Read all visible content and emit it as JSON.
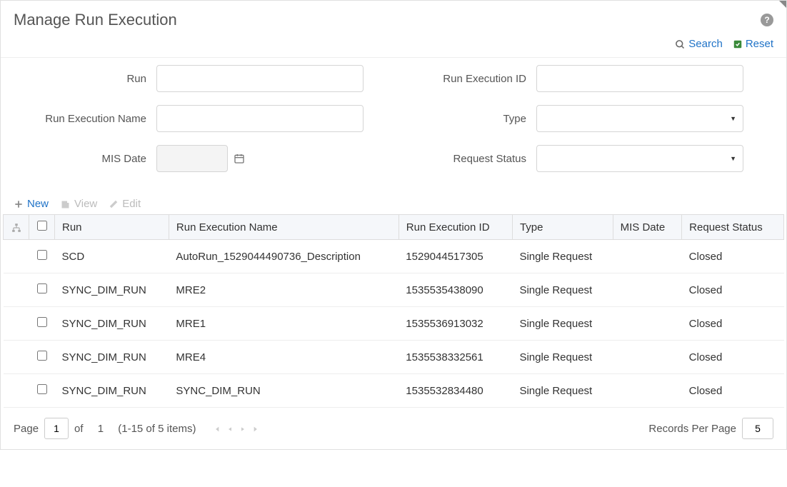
{
  "page_title": "Manage Run Execution",
  "top_actions": {
    "search": "Search",
    "reset": "Reset"
  },
  "form": {
    "run_label": "Run",
    "run_value": "",
    "exec_id_label": "Run Execution ID",
    "exec_id_value": "",
    "exec_name_label": "Run Execution Name",
    "exec_name_value": "",
    "type_label": "Type",
    "type_value": "",
    "mis_date_label": "MIS Date",
    "mis_date_value": "",
    "request_status_label": "Request Status",
    "request_status_value": ""
  },
  "toolbar": {
    "new_label": "New",
    "view_label": "View",
    "edit_label": "Edit"
  },
  "table": {
    "headers": {
      "run": "Run",
      "exec_name": "Run Execution Name",
      "exec_id": "Run Execution ID",
      "type": "Type",
      "mis_date": "MIS Date",
      "request_status": "Request Status"
    },
    "rows": [
      {
        "run": "SCD",
        "exec_name": "AutoRun_1529044490736_Description",
        "exec_id": "1529044517305",
        "type": "Single Request",
        "mis_date": "",
        "request_status": "Closed"
      },
      {
        "run": "SYNC_DIM_RUN",
        "exec_name": "MRE2",
        "exec_id": "1535535438090",
        "type": "Single Request",
        "mis_date": "",
        "request_status": "Closed"
      },
      {
        "run": "SYNC_DIM_RUN",
        "exec_name": "MRE1",
        "exec_id": "1535536913032",
        "type": "Single Request",
        "mis_date": "",
        "request_status": "Closed"
      },
      {
        "run": "SYNC_DIM_RUN",
        "exec_name": "MRE4",
        "exec_id": "1535538332561",
        "type": "Single Request",
        "mis_date": "",
        "request_status": "Closed"
      },
      {
        "run": "SYNC_DIM_RUN",
        "exec_name": "SYNC_DIM_RUN",
        "exec_id": "1535532834480",
        "type": "Single Request",
        "mis_date": "",
        "request_status": "Closed"
      }
    ]
  },
  "pagination": {
    "page_label": "Page",
    "page_value": "1",
    "of_label": "of",
    "total_pages": "1",
    "range_text": "(1-15 of  5 items)",
    "rpp_label": "Records Per Page",
    "rpp_value": "5"
  }
}
